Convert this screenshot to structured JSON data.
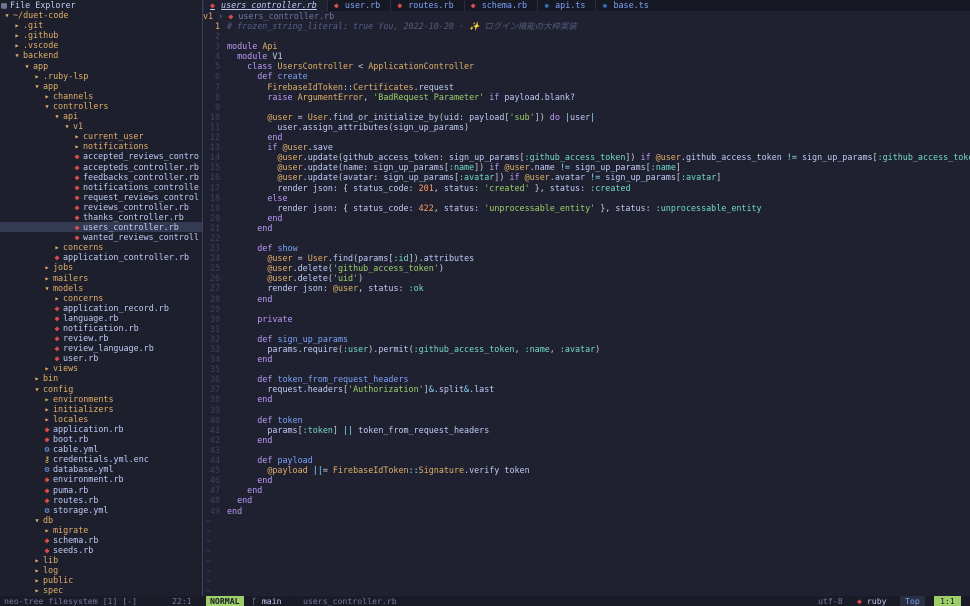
{
  "explorer": {
    "title": "File Explorer",
    "rows": [
      {
        "d": 0,
        "i": "",
        "n": "~/duet-code",
        "t": "dir",
        "o": true
      },
      {
        "d": 1,
        "i": "folder",
        "n": ".git",
        "t": "dir"
      },
      {
        "d": 1,
        "i": "folder",
        "n": ".github",
        "t": "dir"
      },
      {
        "d": 1,
        "i": "folder",
        "n": ".vscode",
        "t": "dir"
      },
      {
        "d": 1,
        "i": "open",
        "n": "backend",
        "t": "dir"
      },
      {
        "d": 2,
        "i": "open",
        "n": "app",
        "t": "dir"
      },
      {
        "d": 3,
        "i": "folder",
        "n": ".ruby-lsp",
        "t": "dir"
      },
      {
        "d": 3,
        "i": "open",
        "n": "app",
        "t": "dir"
      },
      {
        "d": 4,
        "i": "folder",
        "n": "channels",
        "t": "dir"
      },
      {
        "d": 4,
        "i": "open",
        "n": "controllers",
        "t": "dir"
      },
      {
        "d": 5,
        "i": "open",
        "n": "api",
        "t": "dir"
      },
      {
        "d": 6,
        "i": "open",
        "n": "v1",
        "t": "dir"
      },
      {
        "d": 7,
        "i": "folder",
        "n": "current_user",
        "t": "dir"
      },
      {
        "d": 7,
        "i": "folder",
        "n": "notifications",
        "t": "dir"
      },
      {
        "d": 7,
        "i": "ruby",
        "n": "accepted_reviews_contro",
        "t": "file"
      },
      {
        "d": 7,
        "i": "ruby",
        "n": "accepteds_controller.rb",
        "t": "file"
      },
      {
        "d": 7,
        "i": "ruby",
        "n": "feedbacks_controller.rb",
        "t": "file"
      },
      {
        "d": 7,
        "i": "ruby",
        "n": "notifications_controlle",
        "t": "file"
      },
      {
        "d": 7,
        "i": "ruby",
        "n": "request_reviews_control",
        "t": "file"
      },
      {
        "d": 7,
        "i": "ruby",
        "n": "reviews_controller.rb",
        "t": "file"
      },
      {
        "d": 7,
        "i": "ruby",
        "n": "thanks_controller.rb",
        "t": "file"
      },
      {
        "d": 7,
        "i": "ruby",
        "n": "users_controller.rb",
        "t": "file",
        "sel": true
      },
      {
        "d": 7,
        "i": "ruby",
        "n": "wanted_reviews_controll",
        "t": "file"
      },
      {
        "d": 5,
        "i": "folder",
        "n": "concerns",
        "t": "dir"
      },
      {
        "d": 5,
        "i": "ruby",
        "n": "application_controller.rb",
        "t": "file"
      },
      {
        "d": 4,
        "i": "folder",
        "n": "jobs",
        "t": "dir"
      },
      {
        "d": 4,
        "i": "folder",
        "n": "mailers",
        "t": "dir"
      },
      {
        "d": 4,
        "i": "open",
        "n": "models",
        "t": "dir"
      },
      {
        "d": 5,
        "i": "folder",
        "n": "concerns",
        "t": "dir"
      },
      {
        "d": 5,
        "i": "ruby",
        "n": "application_record.rb",
        "t": "file"
      },
      {
        "d": 5,
        "i": "ruby",
        "n": "language.rb",
        "t": "file"
      },
      {
        "d": 5,
        "i": "ruby",
        "n": "notification.rb",
        "t": "file"
      },
      {
        "d": 5,
        "i": "ruby",
        "n": "review.rb",
        "t": "file"
      },
      {
        "d": 5,
        "i": "ruby",
        "n": "review_language.rb",
        "t": "file"
      },
      {
        "d": 5,
        "i": "ruby",
        "n": "user.rb",
        "t": "file"
      },
      {
        "d": 4,
        "i": "folder",
        "n": "views",
        "t": "dir"
      },
      {
        "d": 3,
        "i": "folder",
        "n": "bin",
        "t": "dir"
      },
      {
        "d": 3,
        "i": "open",
        "n": "config",
        "t": "dir"
      },
      {
        "d": 4,
        "i": "folder",
        "n": "environments",
        "t": "dir"
      },
      {
        "d": 4,
        "i": "folder",
        "n": "initializers",
        "t": "dir"
      },
      {
        "d": 4,
        "i": "folder",
        "n": "locales",
        "t": "dir"
      },
      {
        "d": 4,
        "i": "ruby",
        "n": "application.rb",
        "t": "file"
      },
      {
        "d": 4,
        "i": "ruby",
        "n": "boot.rb",
        "t": "file"
      },
      {
        "d": 4,
        "i": "yaml",
        "n": "cable.yml",
        "t": "file"
      },
      {
        "d": 4,
        "i": "gear",
        "n": "credentials.yml.enc",
        "t": "file"
      },
      {
        "d": 4,
        "i": "yaml",
        "n": "database.yml",
        "t": "file"
      },
      {
        "d": 4,
        "i": "ruby",
        "n": "environment.rb",
        "t": "file"
      },
      {
        "d": 4,
        "i": "ruby",
        "n": "puma.rb",
        "t": "file"
      },
      {
        "d": 4,
        "i": "ruby",
        "n": "routes.rb",
        "t": "file"
      },
      {
        "d": 4,
        "i": "yaml",
        "n": "storage.yml",
        "t": "file"
      },
      {
        "d": 3,
        "i": "open",
        "n": "db",
        "t": "dir"
      },
      {
        "d": 4,
        "i": "folder",
        "n": "migrate",
        "t": "dir"
      },
      {
        "d": 4,
        "i": "ruby",
        "n": "schema.rb",
        "t": "file"
      },
      {
        "d": 4,
        "i": "ruby",
        "n": "seeds.rb",
        "t": "file"
      },
      {
        "d": 3,
        "i": "folder",
        "n": "lib",
        "t": "dir"
      },
      {
        "d": 3,
        "i": "folder",
        "n": "log",
        "t": "dir"
      },
      {
        "d": 3,
        "i": "folder",
        "n": "public",
        "t": "dir"
      },
      {
        "d": 3,
        "i": "folder",
        "n": "spec",
        "t": "dir"
      }
    ]
  },
  "tabs": [
    {
      "label": "users_controller.rb",
      "active": true,
      "icon": "ruby"
    },
    {
      "label": "user.rb",
      "active": false,
      "icon": "ruby"
    },
    {
      "label": "routes.rb",
      "active": false,
      "icon": "ruby"
    },
    {
      "label": "schema.rb",
      "active": false,
      "icon": "ruby"
    },
    {
      "label": "api.ts",
      "active": false,
      "icon": "ts"
    },
    {
      "label": "base.ts",
      "active": false,
      "icon": "ts"
    }
  ],
  "breadcrumb": {
    "scope": "v1",
    "file": "users_controller.rb"
  },
  "editor": {
    "first_line_blame": "You, 2022-10-20 · ✨ ログイン機能の大枠実装",
    "lines": [
      "# frozen_string_literal: true",
      "",
      "module Api",
      "  module V1",
      "    class UsersController < ApplicationController",
      "      def create",
      "        FirebaseIdToken::Certificates.request",
      "        raise ArgumentError, 'BadRequest Parameter' if payload.blank?",
      "",
      "        @user = User.find_or_initialize_by(uid: payload['sub']) do |user|",
      "          user.assign_attributes(sign_up_params)",
      "        end",
      "        if @user.save",
      "          @user.update(github_access_token: sign_up_params[:github_access_token]) if @user.github_access_token != sign_up_params[:github_access_token]",
      "          @user.update(name: sign_up_params[:name]) if @user.name != sign_up_params[:name]",
      "          @user.update(avatar: sign_up_params[:avatar]) if @user.avatar != sign_up_params[:avatar]",
      "          render json: { status_code: 201, status: 'created' }, status: :created",
      "        else",
      "          render json: { status_code: 422, status: 'unprocessable_entity' }, status: :unprocessable_entity",
      "        end",
      "      end",
      "",
      "      def show",
      "        @user = User.find(params[:id]).attributes",
      "        @user.delete('github_access_token')",
      "        @user.delete('uid')",
      "        render json: @user, status: :ok",
      "      end",
      "",
      "      private",
      "",
      "      def sign_up_params",
      "        params.require(:user).permit(:github_access_token, :name, :avatar)",
      "      end",
      "",
      "      def token_from_request_headers",
      "        request.headers['Authorization']&.split&.last",
      "      end",
      "",
      "      def token",
      "        params[:token] || token_from_request_headers",
      "      end",
      "",
      "      def payload",
      "        @payload ||= FirebaseIdToken::Signature.verify token",
      "      end",
      "    end",
      "  end",
      "end"
    ],
    "tilde_rows": 8
  },
  "statusline": {
    "tree_label": "neo-tree filesystem [1] [-]",
    "tree_pos": "22:1",
    "mode": "NORMAL",
    "branch": "main",
    "file": "users_controller.rb",
    "encoding": "utf-8",
    "filetype": "ruby",
    "scroll": "Top",
    "cursor": "1:1"
  }
}
